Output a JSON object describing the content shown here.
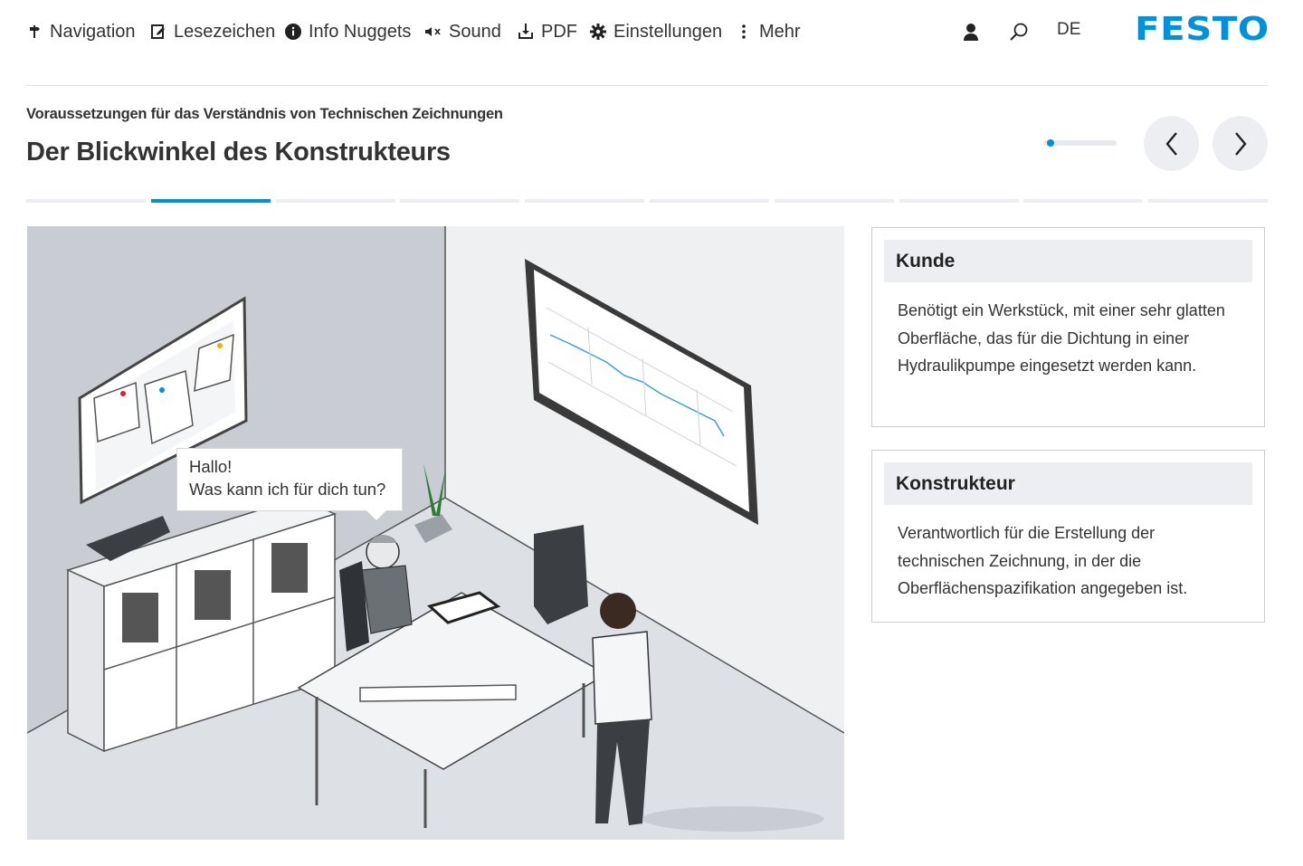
{
  "topnav": {
    "items": [
      {
        "label": "Navigation",
        "icon": "signpost-icon"
      },
      {
        "label": "Lesezeichen",
        "icon": "bookmark-edit-icon"
      },
      {
        "label": "Info Nuggets",
        "icon": "info-icon"
      },
      {
        "label": "Sound",
        "icon": "sound-muted-icon"
      },
      {
        "label": "PDF",
        "icon": "pdf-download-icon"
      },
      {
        "label": "Einstellungen",
        "icon": "gear-icon"
      },
      {
        "label": "Mehr",
        "icon": "more-vertical-icon"
      }
    ],
    "language": "DE",
    "logo": "FESTO",
    "brand_color": "#0091dc"
  },
  "header": {
    "subtitle": "Voraussetzungen für das Verständnis von Technischen Zeichnungen",
    "title": "Der Blickwinkel des Konstrukteurs"
  },
  "progress": {
    "fraction": 0.05
  },
  "steps": {
    "count": 10,
    "active_index": 1
  },
  "scene": {
    "speech_line1": "Hallo!",
    "speech_line2": "Was kann ich für dich tun?"
  },
  "cards": [
    {
      "title": "Kunde",
      "text": "Benötigt ein Werkstück, mit einer sehr glatten Oberfläche, das für die Dichtung in einer Hydraulikpumpe eingesetzt werden kann."
    },
    {
      "title": "Konstrukteur",
      "text": "Verantwortlich für die Erstellung der technischen Zeichnung, in der die Oberflächenspazifikation angegeben ist."
    }
  ]
}
